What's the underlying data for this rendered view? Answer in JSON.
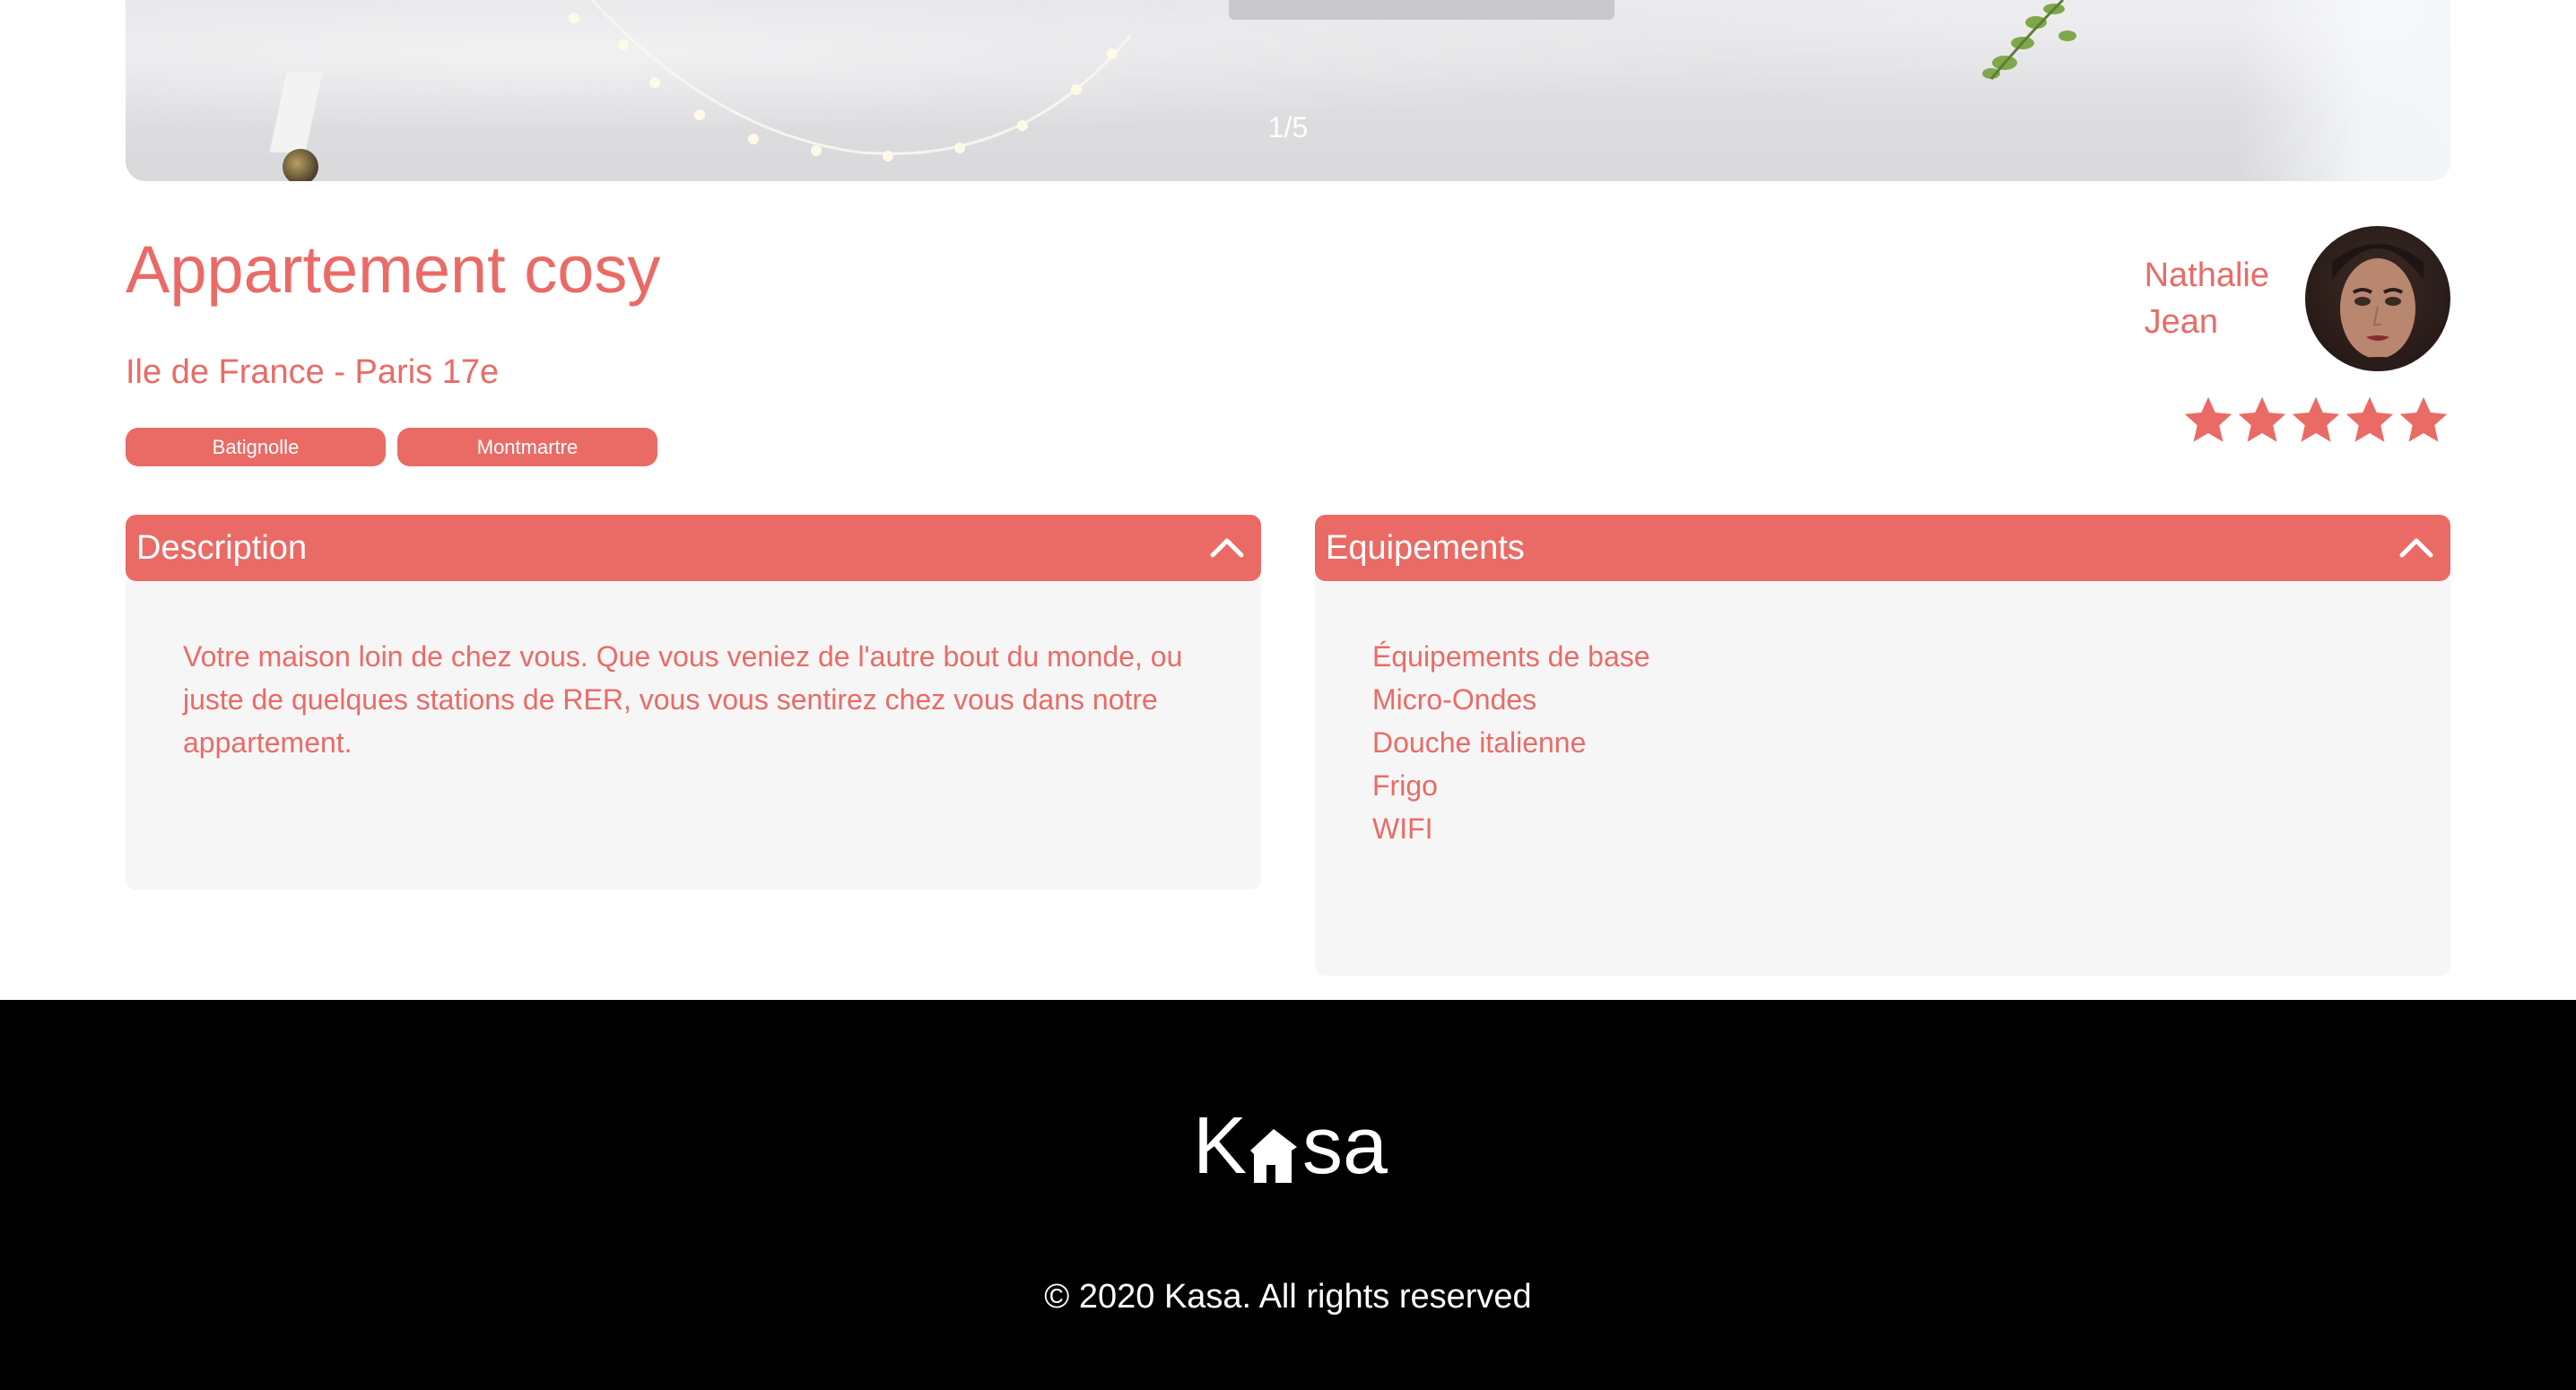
{
  "gallery": {
    "counter": "1/5",
    "current_image": 1,
    "total_images": 5
  },
  "listing": {
    "title": "Appartement cosy",
    "location": "Ile de France - Paris 17e",
    "tags": [
      "Batignolle",
      "Montmartre"
    ]
  },
  "host": {
    "first_name": "Nathalie",
    "last_name": "Jean"
  },
  "rating": {
    "value": 5,
    "max": 5
  },
  "description": {
    "title": "Description",
    "text": "Votre maison loin de chez vous. Que vous veniez de l'autre bout du monde, ou juste de quelques stations de RER, vous vous sentirez chez vous dans notre appartement."
  },
  "equipments": {
    "title": "Equipements",
    "items": [
      "Équipements de base",
      "Micro-Ondes",
      "Douche italienne",
      "Frigo",
      "WIFI"
    ]
  },
  "footer": {
    "logo_k": "K",
    "logo_rest": "sa",
    "copyright": "© 2020 Kasa. All rights reserved"
  },
  "colors": {
    "accent": "#ea6b66",
    "panel_bg": "#f6f6f6",
    "footer_bg": "#000000",
    "text_light": "#ffffff"
  }
}
